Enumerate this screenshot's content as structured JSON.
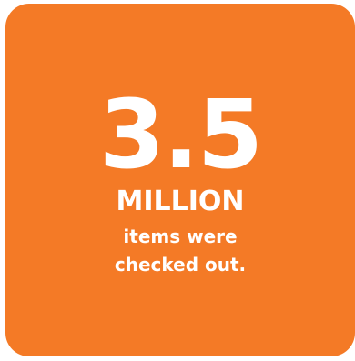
{
  "card": {
    "background_color": "#F47A26",
    "text_color": "#FFFFFF"
  },
  "stat": {
    "value": "3.5",
    "unit": "MILLION",
    "caption_line1": "items were",
    "caption_line2": "checked out."
  }
}
